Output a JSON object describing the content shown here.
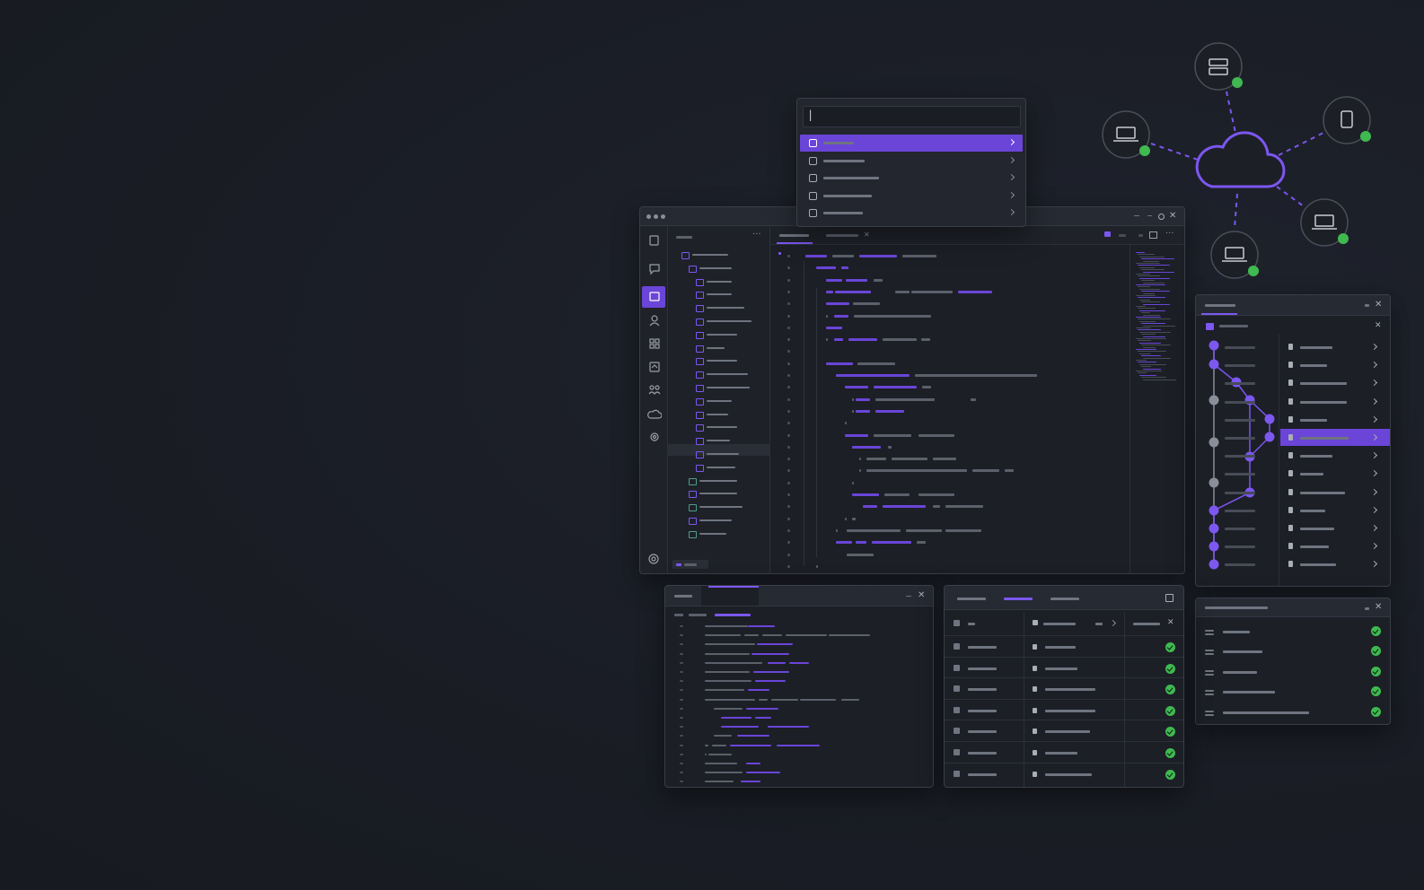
{
  "colors": {
    "background": "#1a1d25",
    "panel": "#1c1f26",
    "accent": "#6a45d8",
    "success": "#3fb950",
    "border": "#3a3e48"
  },
  "command_palette": {
    "input_value": "|",
    "items": [
      {
        "icon": "file-icon",
        "selected": true
      },
      {
        "icon": "file-icon",
        "selected": false
      },
      {
        "icon": "file-icon",
        "selected": false
      },
      {
        "icon": "file-icon",
        "selected": false
      },
      {
        "icon": "database-icon",
        "selected": false
      }
    ]
  },
  "editor": {
    "activity_bar": [
      "files-icon",
      "chat-icon",
      "source-control-icon",
      "user-icon",
      "extensions-icon",
      "debug-icon",
      "team-icon",
      "cloud-icon",
      "settings-icon"
    ],
    "active_activity": 2
  },
  "cloud_diagram": {
    "nodes": [
      "server-icon",
      "tablet-icon",
      "laptop-icon",
      "laptop-icon",
      "laptop-icon"
    ]
  },
  "status_panel": {
    "rows": 5
  },
  "table_panel": {
    "rows": 7
  }
}
